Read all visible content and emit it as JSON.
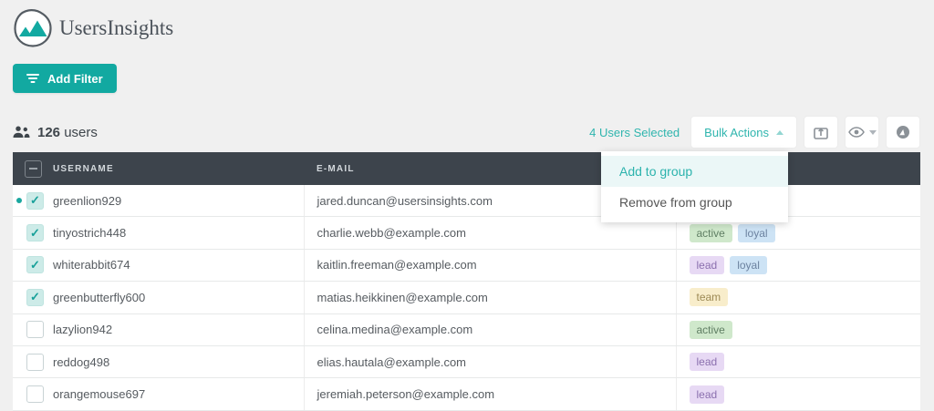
{
  "brand": {
    "name": "UsersInsights"
  },
  "colors": {
    "accent_teal": "#12a9a1",
    "link_teal": "#2fb5ae",
    "table_header_bg": "#3d444c",
    "page_bg": "#f0f0f0"
  },
  "icons": {
    "logo": "two-teal-mountains-in-pick-outline",
    "filter": "three-stacked-lines",
    "users": "two-person-silhouettes",
    "check_glyph": "✓",
    "indeterminate_glyph": "-",
    "caret_up": "triangle-up",
    "caret_down": "triangle-down",
    "export": "window-with-up-arrow",
    "eye": "eye-outline-with-pupil",
    "globe": "filled-circle-with-white-wedge"
  },
  "filter_button": {
    "label": "Add Filter"
  },
  "toolbar": {
    "users_count": "126",
    "users_label": "users",
    "selected_text": "4 Users Selected",
    "bulk_actions_label": "Bulk Actions"
  },
  "dropdown": {
    "items": [
      {
        "label": "Add to group",
        "highlighted": true
      },
      {
        "label": "Remove from group",
        "highlighted": false
      }
    ]
  },
  "table": {
    "headers": {
      "username": "USERNAME",
      "email": "E-MAIL"
    },
    "rows": [
      {
        "username": "greenlion929",
        "email": "jared.duncan@usersinsights.com",
        "tags": [],
        "checked": true,
        "dot": true
      },
      {
        "username": "tinyostrich448",
        "email": "charlie.webb@example.com",
        "tags": [
          "active",
          "loyal"
        ],
        "checked": true,
        "dot": false
      },
      {
        "username": "whiterabbit674",
        "email": "kaitlin.freeman@example.com",
        "tags": [
          "lead",
          "loyal"
        ],
        "checked": true,
        "dot": false
      },
      {
        "username": "greenbutterfly600",
        "email": "matias.heikkinen@example.com",
        "tags": [
          "team"
        ],
        "checked": true,
        "dot": false
      },
      {
        "username": "lazylion942",
        "email": "celina.medina@example.com",
        "tags": [
          "active"
        ],
        "checked": false,
        "dot": false
      },
      {
        "username": "reddog498",
        "email": "elias.hautala@example.com",
        "tags": [
          "lead"
        ],
        "checked": false,
        "dot": false
      },
      {
        "username": "orangemouse697",
        "email": "jeremiah.peterson@example.com",
        "tags": [
          "lead"
        ],
        "checked": false,
        "dot": false
      }
    ],
    "tag_colors": {
      "active": {
        "bg": "#cfe8cb",
        "text": "#5f7e63"
      },
      "loyal": {
        "bg": "#cde3f5",
        "text": "#6c82a0"
      },
      "lead": {
        "bg": "#e7d9f4",
        "text": "#8b6fae"
      },
      "team": {
        "bg": "#f8edcb",
        "text": "#9d8a55"
      }
    }
  }
}
